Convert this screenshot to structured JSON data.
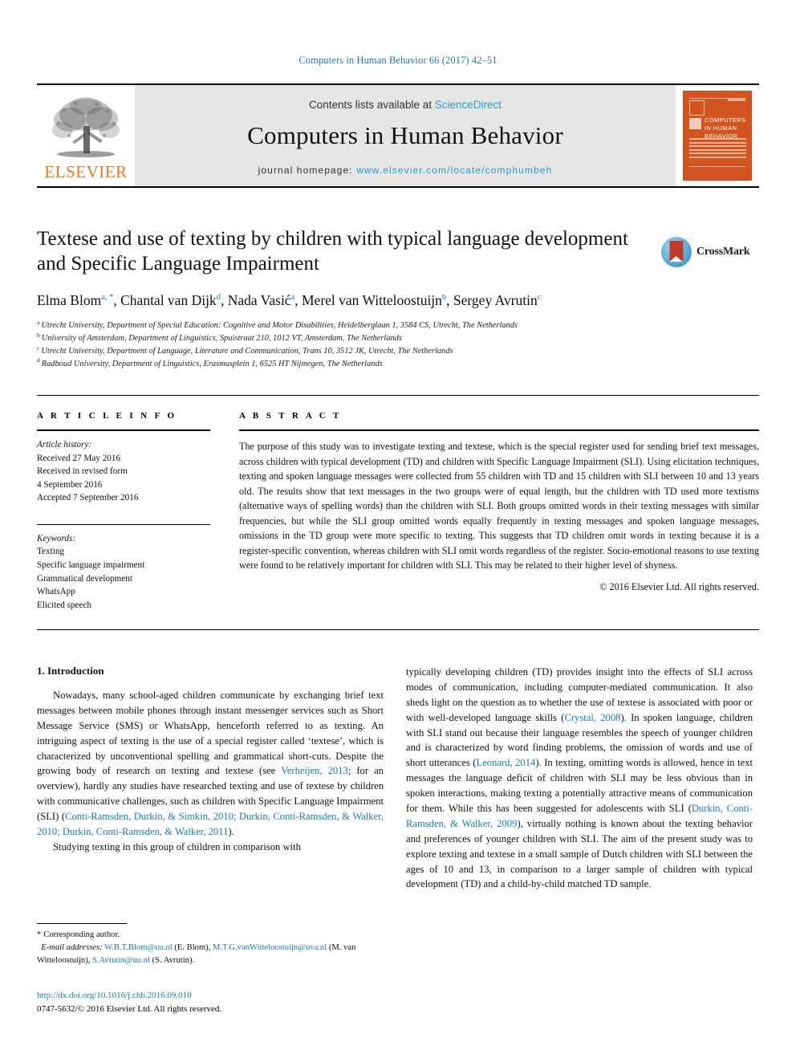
{
  "running_head": "Computers in Human Behavior 66 (2017) 42–51",
  "masthead": {
    "contents_prefix": "Contents lists available at ",
    "sciencedirect": "ScienceDirect",
    "journal_name": "Computers in Human Behavior",
    "homepage_label": "journal homepage: ",
    "homepage_url": "www.elsevier.com/locate/comphumbeh",
    "publisher": "ELSEVIER",
    "cover_title": "COMPUTERS IN HUMAN BEHAVIOR"
  },
  "crossmark": {
    "label": "CrossMark"
  },
  "article": {
    "title": "Textese and use of texting by children with typical language development and Specific Language Impairment",
    "authors": [
      {
        "name": "Elma Blom",
        "sup": "a, *"
      },
      {
        "name": "Chantal van Dijk",
        "sup": "d"
      },
      {
        "name": "Nada Vasić",
        "sup": "a"
      },
      {
        "name": "Merel van Witteloostuijn",
        "sup": "b"
      },
      {
        "name": "Sergey Avrutin",
        "sup": "c"
      }
    ],
    "affiliations": [
      {
        "mark": "a",
        "text": "Utrecht University, Department of Special Education: Cognitive and Motor Disabilities, Heidelberglaan 1, 3584 CS, Utrecht, The Netherlands"
      },
      {
        "mark": "b",
        "text": "University of Amsterdam, Department of Linguistics, Spuistraat 210, 1012 VT, Amsterdam, The Netherlands"
      },
      {
        "mark": "c",
        "text": "Utrecht University, Department of Language, Literature and Communication, Trans 10, 3512 JK, Utrecht, The Netherlands"
      },
      {
        "mark": "d",
        "text": "Radboud University, Department of Linguistics, Erasmusplein 1, 6525 HT Nijmegen, The Netherlands"
      }
    ]
  },
  "article_info": {
    "heading": "A R T I C L E  I N F O",
    "history_label": "Article history:",
    "history": [
      "Received 27 May 2016",
      "Received in revised form",
      "4 September 2016",
      "Accepted 7 September 2016"
    ],
    "keywords_label": "Keywords:",
    "keywords": [
      "Texting",
      "Specific language impairment",
      "Grammatical development",
      "WhatsApp",
      "Elicited speech"
    ]
  },
  "abstract": {
    "heading": "A B S T R A C T",
    "text": "The purpose of this study was to investigate texting and textese, which is the special register used for sending brief text messages, across children with typical development (TD) and children with Specific Language Impairment (SLI). Using elicitation techniques, texting and spoken language messages were collected from 55 children with TD and 15 children with SLI between 10 and 13 years old. The results show that text messages in the two groups were of equal length, but the children with TD used more textisms (alternative ways of spelling words) than the children with SLI. Both groups omitted words in their texting messages with similar frequencies, but while the SLI group omitted words equally frequently in texting messages and spoken language messages, omissions in the TD group were more specific to texting. This suggests that TD children omit words in texting because it is a register-specific convention, whereas children with SLI omit words regardless of the register. Socio-emotional reasons to use texting were found to be relatively important for children with SLI. This may be related to their higher level of shyness.",
    "copyright": "© 2016 Elsevier Ltd. All rights reserved."
  },
  "body": {
    "section_number_title": "1. Introduction",
    "left_paragraph_1_a": "Nowadays, many school-aged children communicate by exchanging brief text messages between mobile phones through instant messenger services such as Short Message Service (SMS) or WhatsApp, henceforth referred to as texting. An intriguing aspect of texting is the use of a special register called ‘textese’, which is characterized by unconventional spelling and grammatical short-cuts. Despite the growing body of research on texting and textese (see ",
    "left_ref_1": "Verheijen, 2013",
    "left_paragraph_1_b": "; for an overview), hardly any studies have researched texting and use of textese by children with communicative challenges, such as children with Specific Language Impairment (SLI) (",
    "left_ref_2": "Conti-Ramsden, Durkin, & Simkin, 2010; Durkin, Conti-Ramsden, & Walker, 2010; Durkin, Conti-Ramsden, & Walker, 2011",
    "left_paragraph_1_c": ").",
    "left_paragraph_2": "Studying texting in this group of children in comparison with",
    "right_paragraph_a": "typically developing children (TD) provides insight into the effects of SLI across modes of communication, including computer-mediated communication. It also sheds light on the question as to whether the use of textese is associated with poor or with well-developed language skills (",
    "right_ref_1": "Crystal, 2008",
    "right_paragraph_b": "). In spoken language, children with SLI stand out because their language resembles the speech of younger children and is characterized by word finding problems, the omission of words and use of short utterances (",
    "right_ref_2": "Leonard, 2014",
    "right_paragraph_c": "). In texting, omitting words is allowed, hence in text messages the language deficit of children with SLI may be less obvious than in spoken interactions, making texting a potentially attractive means of communication for them. While this has been suggested for adolescents with SLI (",
    "right_ref_3": "Durkin, Conti-Ramsden, & Walker, 2009",
    "right_paragraph_d": "), virtually nothing is known about the texting behavior and preferences of younger children with SLI. The aim of the present study was to explore texting and textese in a small sample of Dutch children with SLI between the ages of 10 and 13, in comparison to a larger sample of children with typical development (TD) and a child-by-child matched TD sample."
  },
  "footnote": {
    "star": "*",
    "corresponding": "Corresponding author.",
    "email_label": "E-mail addresses:",
    "email_1": "W.B.T.Blom@uu.nl",
    "email_1_owner": "(E. Blom),",
    "email_2": "M.T.G.vanWitteloostuijn@uva.nl",
    "email_2_owner": "(M. van Witteloostuijn),",
    "email_3": "S.Avrutin@uu.nl",
    "email_3_owner": "(S. Avrutin)."
  },
  "doi": {
    "url": "http://dx.doi.org/10.1016/j.chb.2016.09.010",
    "issn_line": "0747-5632/© 2016 Elsevier Ltd. All rights reserved."
  },
  "colors": {
    "link_blue": "#1a7bad",
    "elsevier_orange": "#e87722",
    "band_gray": "#e6e6e6",
    "cover_orange": "#d4541f"
  }
}
